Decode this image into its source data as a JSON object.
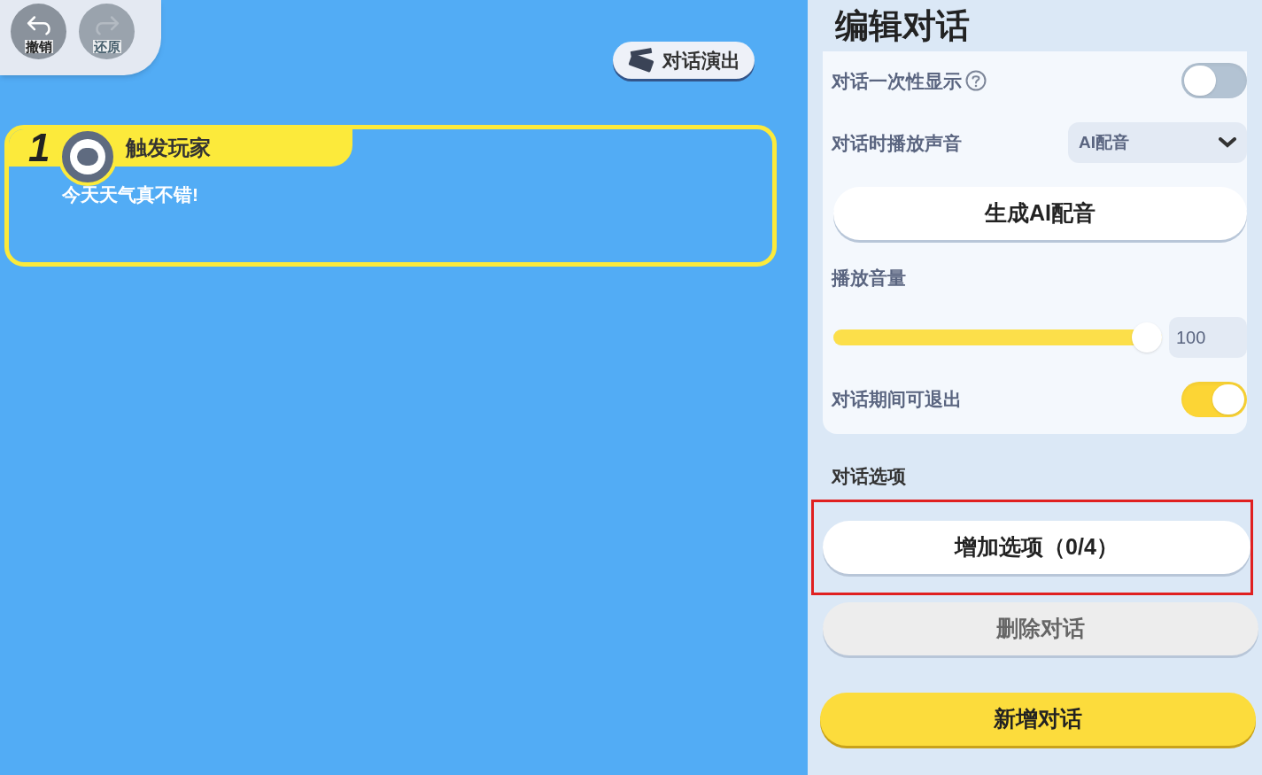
{
  "toolbar": {
    "undo": {
      "label": "撤销",
      "disabled": false
    },
    "redo": {
      "label": "还原",
      "disabled": true
    }
  },
  "performance_button": {
    "label": "对话演出"
  },
  "dialogue": {
    "number": "1",
    "speaker": "触发玩家",
    "text": "今天天气真不错!"
  },
  "panel": {
    "title": "编辑对话",
    "settings": [
      {
        "kind": "toggle",
        "label": "对话一次性显示",
        "help": true,
        "on": false
      },
      {
        "kind": "dropdown",
        "label": "对话时播放声音",
        "value": "AI配音"
      },
      {
        "kind": "button",
        "label": "生成AI配音"
      },
      {
        "kind": "slider",
        "label": "播放音量",
        "level": 1.0,
        "value": "100"
      },
      {
        "kind": "toggle",
        "label": "对话期间可退出",
        "help": false,
        "on": true
      }
    ],
    "options_title": "对话选项",
    "add_option": "增加选项（0/4）",
    "delete": "删除对话",
    "new_dialogue": "新增对话"
  }
}
